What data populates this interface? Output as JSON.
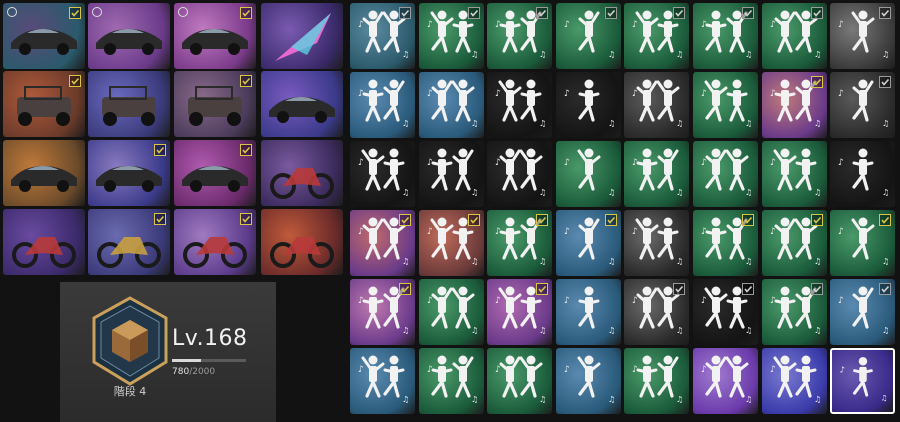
{
  "vehicles": [
    {
      "name": "black-sports-car-skin",
      "bg": [
        "#2a5a6b",
        "#5a4a7a"
      ],
      "checked": true,
      "check_style": "yellow",
      "badge": "gear-icon"
    },
    {
      "name": "white-suv-skin",
      "bg": [
        "#6a3a8a",
        "#a06ab0"
      ],
      "checked": false,
      "badge": "gear-icon"
    },
    {
      "name": "dark-coupe-skin",
      "bg": [
        "#7a3a8a",
        "#c07ac0"
      ],
      "checked": true,
      "check_style": "yellow",
      "badge": "gear-icon"
    },
    {
      "name": "rainbow-glider-skin",
      "bg": [
        "#3a2a6a",
        "#7a5ab0"
      ],
      "checked": false
    },
    {
      "name": "red-buggy-skin",
      "bg": [
        "#6a3a2a",
        "#b05a3a"
      ],
      "checked": true,
      "check_style": "yellow"
    },
    {
      "name": "pink-buggy-skin",
      "bg": [
        "#3a3a7a",
        "#6a6ac0"
      ],
      "checked": false
    },
    {
      "name": "offroad-jeep-skin",
      "bg": [
        "#4a3a5a",
        "#8a6a8a"
      ],
      "checked": true,
      "check_style": "yellow"
    },
    {
      "name": "graffiti-car-skin",
      "bg": [
        "#3a3a8a",
        "#7a5ac0"
      ],
      "checked": false
    },
    {
      "name": "gold-muscle-car-skin",
      "bg": [
        "#6a4a2a",
        "#c07a3a"
      ],
      "checked": false
    },
    {
      "name": "blue-sedan-skin",
      "bg": [
        "#3a3a8a",
        "#8a7ac0"
      ],
      "checked": true,
      "check_style": "yellow"
    },
    {
      "name": "pink-sports-car-skin",
      "bg": [
        "#6a2a6a",
        "#b05ab0"
      ],
      "checked": true,
      "check_style": "yellow"
    },
    {
      "name": "dirt-bike-skin",
      "bg": [
        "#3a2a5a",
        "#7a5aa0"
      ],
      "checked": false
    },
    {
      "name": "red-motorcycle-skin",
      "bg": [
        "#3a2a6a",
        "#6a4aa0"
      ],
      "checked": false
    },
    {
      "name": "gold-bicycle-skin",
      "bg": [
        "#3a3a7a",
        "#6a6ab0"
      ],
      "checked": true,
      "check_style": "yellow"
    },
    {
      "name": "pink-dirt-bike-skin",
      "bg": [
        "#5a3a8a",
        "#a07ac0"
      ],
      "checked": true,
      "check_style": "yellow"
    },
    {
      "name": "scooter-skin",
      "bg": [
        "#6a2a2a",
        "#c05a3a"
      ],
      "checked": false
    }
  ],
  "emotes": [
    {
      "name": "emote-1-1",
      "bg": [
        "#2a5a6a",
        "#5a8aa0"
      ],
      "checked": true,
      "check_style": "gray"
    },
    {
      "name": "emote-1-2",
      "bg": [
        "#1a5a3a",
        "#4a9a6a"
      ],
      "checked": true,
      "check_style": "gray"
    },
    {
      "name": "emote-1-3",
      "bg": [
        "#1a5a3a",
        "#4a9a6a"
      ],
      "checked": true,
      "check_style": "gray"
    },
    {
      "name": "emote-1-4",
      "bg": [
        "#1a5a3a",
        "#4a9a6a"
      ],
      "checked": true,
      "check_style": "gray"
    },
    {
      "name": "emote-1-5",
      "bg": [
        "#1a5a3a",
        "#4a9a6a"
      ],
      "checked": true,
      "check_style": "gray"
    },
    {
      "name": "emote-1-6",
      "bg": [
        "#1a5a3a",
        "#4a9a6a"
      ],
      "checked": true,
      "check_style": "gray"
    },
    {
      "name": "emote-1-7",
      "bg": [
        "#1a5a3a",
        "#4a9a6a"
      ],
      "checked": true,
      "check_style": "gray"
    },
    {
      "name": "emote-1-8",
      "bg": [
        "#3a3a3a",
        "#7a7a7a"
      ],
      "checked": true,
      "check_style": "gray"
    },
    {
      "name": "emote-2-1",
      "bg": [
        "#2a5a7a",
        "#5a8ab0"
      ],
      "checked": false
    },
    {
      "name": "emote-2-2",
      "bg": [
        "#2a5a7a",
        "#5a8ab0"
      ],
      "checked": false
    },
    {
      "name": "emote-2-3",
      "bg": [
        "#141414",
        "#2a2a2a"
      ],
      "checked": false
    },
    {
      "name": "emote-2-4",
      "bg": [
        "#141414",
        "#2a2a2a"
      ],
      "checked": false
    },
    {
      "name": "emote-2-5",
      "bg": [
        "#2a2a2a",
        "#5a5a5a"
      ],
      "checked": false
    },
    {
      "name": "emote-2-6",
      "bg": [
        "#1a5a3a",
        "#4a9a6a"
      ],
      "checked": false
    },
    {
      "name": "emote-2-7",
      "bg": [
        "#6a3a8a",
        "#c07a7a"
      ],
      "checked": true,
      "check_style": "yellow"
    },
    {
      "name": "emote-2-8",
      "bg": [
        "#2a2a2a",
        "#5a5a5a"
      ],
      "checked": true,
      "check_style": "gray"
    },
    {
      "name": "emote-3-1",
      "bg": [
        "#141414",
        "#2a2a2a"
      ],
      "checked": false
    },
    {
      "name": "emote-3-2",
      "bg": [
        "#141414",
        "#2a2a2a"
      ],
      "checked": false
    },
    {
      "name": "emote-3-3",
      "bg": [
        "#141414",
        "#2a2a2a"
      ],
      "checked": false
    },
    {
      "name": "emote-3-4",
      "bg": [
        "#1a5a3a",
        "#4a9a6a"
      ],
      "checked": false
    },
    {
      "name": "emote-3-5",
      "bg": [
        "#1a5a3a",
        "#4a9a6a"
      ],
      "checked": false
    },
    {
      "name": "emote-3-6",
      "bg": [
        "#1a5a3a",
        "#4a9a6a"
      ],
      "checked": false
    },
    {
      "name": "emote-3-7",
      "bg": [
        "#1a5a3a",
        "#4a9a6a"
      ],
      "checked": false
    },
    {
      "name": "emote-3-8",
      "bg": [
        "#141414",
        "#2a2a2a"
      ],
      "checked": false
    },
    {
      "name": "emote-4-1",
      "bg": [
        "#6a3a8a",
        "#c06a6a"
      ],
      "checked": true,
      "check_style": "yellow"
    },
    {
      "name": "emote-4-2",
      "bg": [
        "#6a3a3a",
        "#c06a5a"
      ],
      "checked": true,
      "check_style": "yellow"
    },
    {
      "name": "emote-4-3",
      "bg": [
        "#1a5a3a",
        "#4a9a6a"
      ],
      "checked": true,
      "check_style": "yellow"
    },
    {
      "name": "emote-4-4",
      "bg": [
        "#2a5a7a",
        "#5a8ab0"
      ],
      "checked": true,
      "check_style": "yellow"
    },
    {
      "name": "emote-4-5",
      "bg": [
        "#2a2a2a",
        "#6a6a6a"
      ],
      "checked": false
    },
    {
      "name": "emote-4-6",
      "bg": [
        "#1a5a3a",
        "#4a9a6a"
      ],
      "checked": true,
      "check_style": "yellow"
    },
    {
      "name": "emote-4-7",
      "bg": [
        "#1a5a3a",
        "#4a9a6a"
      ],
      "checked": true,
      "check_style": "yellow"
    },
    {
      "name": "emote-4-8",
      "bg": [
        "#1a5a3a",
        "#4a9a6a"
      ],
      "checked": true,
      "check_style": "yellow"
    },
    {
      "name": "emote-5-1",
      "bg": [
        "#6a3a8a",
        "#c07ab0"
      ],
      "checked": true,
      "check_style": "yellow"
    },
    {
      "name": "emote-5-2",
      "bg": [
        "#1a5a3a",
        "#4a9a6a"
      ],
      "checked": false
    },
    {
      "name": "emote-5-3",
      "bg": [
        "#6a3a8a",
        "#b06ab0"
      ],
      "checked": true,
      "check_style": "yellow"
    },
    {
      "name": "emote-5-4",
      "bg": [
        "#2a5a7a",
        "#5a8ab0"
      ],
      "checked": false
    },
    {
      "name": "emote-5-5",
      "bg": [
        "#2a2a2a",
        "#6a6a6a"
      ],
      "checked": true,
      "check_style": "gray"
    },
    {
      "name": "emote-5-6",
      "bg": [
        "#141414",
        "#2a2a2a"
      ],
      "checked": true,
      "check_style": "gray"
    },
    {
      "name": "emote-5-7",
      "bg": [
        "#1a5a3a",
        "#4a9a6a"
      ],
      "checked": true,
      "check_style": "gray"
    },
    {
      "name": "emote-5-8",
      "bg": [
        "#2a5a7a",
        "#5a8ab0"
      ],
      "checked": true,
      "check_style": "gray"
    },
    {
      "name": "emote-6-1",
      "bg": [
        "#2a5a7a",
        "#5a8ab0"
      ],
      "checked": false
    },
    {
      "name": "emote-6-2",
      "bg": [
        "#1a5a3a",
        "#4a9a6a"
      ],
      "checked": false
    },
    {
      "name": "emote-6-3",
      "bg": [
        "#1a5a3a",
        "#4a9a6a"
      ],
      "checked": false
    },
    {
      "name": "emote-6-4",
      "bg": [
        "#2a5a7a",
        "#5a8ab0"
      ],
      "checked": false
    },
    {
      "name": "emote-6-5",
      "bg": [
        "#1a5a3a",
        "#4a9a6a"
      ],
      "checked": false
    },
    {
      "name": "emote-6-6",
      "bg": [
        "#6a3aaa",
        "#a07ad0"
      ],
      "checked": false
    },
    {
      "name": "emote-6-7",
      "bg": [
        "#3a3aaa",
        "#7a7ad0"
      ],
      "checked": false
    },
    {
      "name": "emote-6-8",
      "bg": [
        "#3a2a8a",
        "#6a5ab0"
      ],
      "checked": false,
      "selected": true
    }
  ],
  "profile": {
    "level_label": "Lv.168",
    "xp_current": "780",
    "xp_max": "/2000",
    "xp_fraction": 0.39,
    "stage_label": "階段 4",
    "badge_icon": "bronze-tier-hexagon-badge"
  },
  "colors": {
    "check_yellow": "#d9c445",
    "check_gray": "#9a9a9a",
    "selected_border": "#ffffff"
  }
}
